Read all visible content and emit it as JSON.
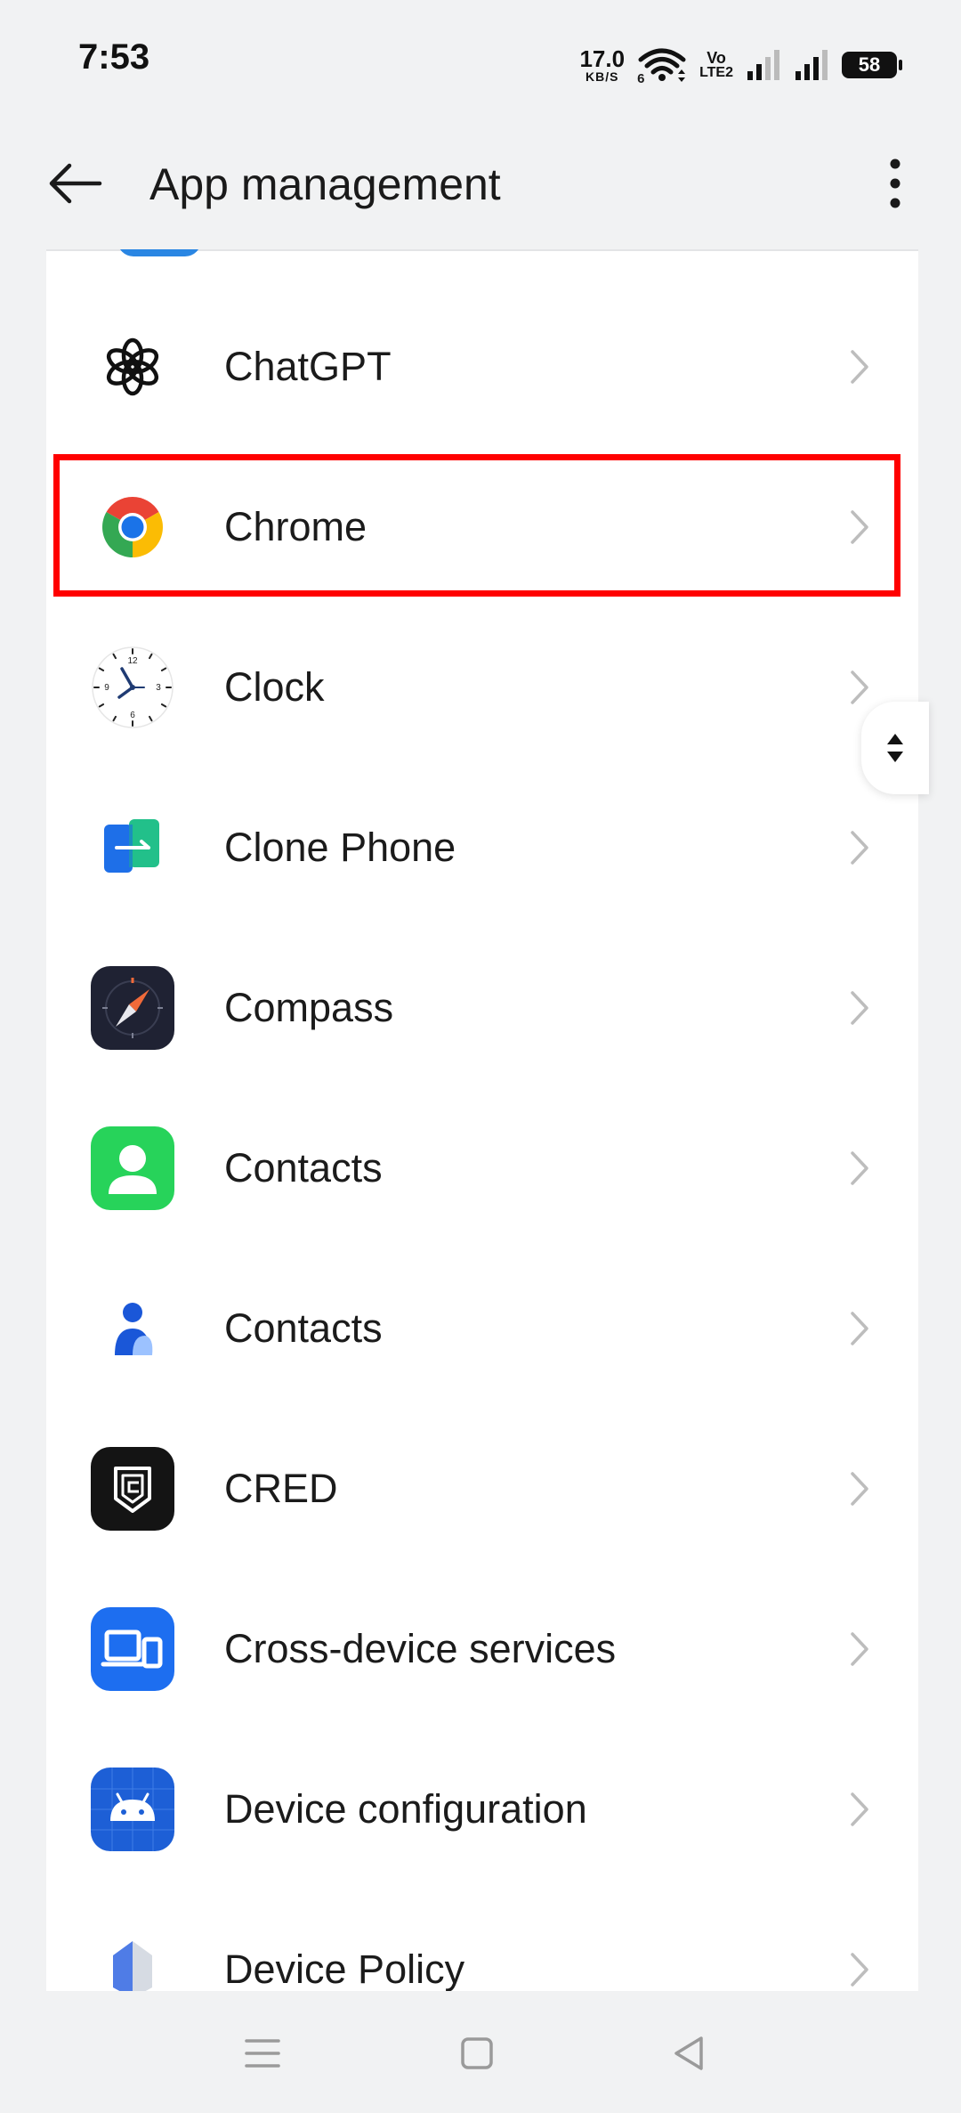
{
  "status_bar": {
    "time": "7:53",
    "net_speed_value": "17.0",
    "net_speed_unit": "KB/S",
    "volte_top": "Vo",
    "volte_bottom": "LTE2",
    "wifi_label": "6",
    "battery": "58"
  },
  "header": {
    "title": "App management",
    "back_icon": "arrow-left-icon",
    "more_icon": "more-vertical-icon"
  },
  "apps": [
    {
      "name": "ChatGPT",
      "icon": "chatgpt-icon"
    },
    {
      "name": "Chrome",
      "icon": "chrome-icon"
    },
    {
      "name": "Clock",
      "icon": "clock-icon"
    },
    {
      "name": "Clone Phone",
      "icon": "clone-phone-icon"
    },
    {
      "name": "Compass",
      "icon": "compass-icon"
    },
    {
      "name": "Contacts",
      "icon": "contacts-green-icon"
    },
    {
      "name": "Contacts",
      "icon": "contacts-blue-icon"
    },
    {
      "name": "CRED",
      "icon": "cred-icon"
    },
    {
      "name": "Cross-device services",
      "icon": "cross-device-icon"
    },
    {
      "name": "Device configuration",
      "icon": "android-icon"
    },
    {
      "name": "Device Policy",
      "icon": "device-policy-icon"
    }
  ],
  "colors": {
    "highlight": "#ff0000",
    "background": "#f1f2f3",
    "card": "#ffffff",
    "chevron": "#bdbdbd"
  },
  "clock_face": {
    "n12": "12",
    "n3": "3",
    "n6": "6",
    "n9": "9"
  }
}
